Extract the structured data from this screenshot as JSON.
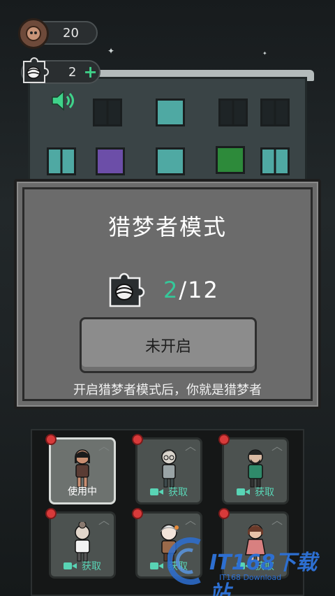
{
  "hud": {
    "coins": "20",
    "pieces": "2",
    "plus_symbol": "+"
  },
  "modal": {
    "title": "猎梦者模式",
    "progress_current": "2",
    "progress_total": "/12",
    "status_button": "未开启",
    "description": "开启猎梦者模式后，你就是猎梦者"
  },
  "characters": [
    {
      "state": "使用中",
      "active": true
    },
    {
      "state": "获取",
      "active": false
    },
    {
      "state": "获取",
      "active": false
    },
    {
      "state": "获取",
      "active": false
    },
    {
      "state": "获取",
      "active": false
    },
    {
      "state": "获取",
      "active": false
    }
  ],
  "watermark": {
    "text": "IT168下载站",
    "sub": "IT168 Download"
  },
  "colors": {
    "accent_green": "#35c89a",
    "obtain_teal": "#59d4b5",
    "badge_red": "#d83a3a"
  }
}
